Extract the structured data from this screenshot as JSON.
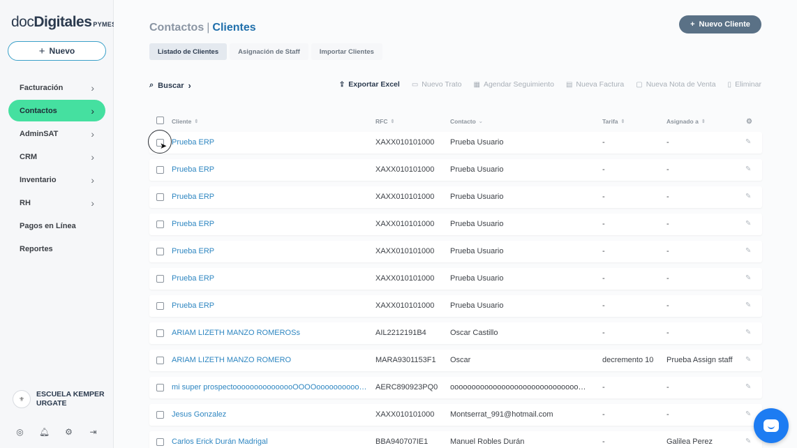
{
  "logo": {
    "doc": "doc",
    "digitales": "Digitales",
    "suffix": "PYMES"
  },
  "sidebar": {
    "new_button": "Nuevo",
    "items": [
      {
        "label": "Facturación",
        "chevron": true
      },
      {
        "label": "Contactos",
        "chevron": true
      },
      {
        "label": "AdminSAT",
        "chevron": true
      },
      {
        "label": "CRM",
        "chevron": true
      },
      {
        "label": "Inventario",
        "chevron": true
      },
      {
        "label": "RH",
        "chevron": true
      },
      {
        "label": "Pagos en Línea",
        "chevron": false
      },
      {
        "label": "Reportes",
        "chevron": false
      }
    ],
    "active_item": "Contactos",
    "org_name": "ESCUELA KEMPER URGATE",
    "footer_icons": [
      "user-icon",
      "bell-icon",
      "gear-icon",
      "logout-icon"
    ]
  },
  "header": {
    "section": "Contactos",
    "page": "Clientes",
    "new_client_button": "Nuevo Cliente"
  },
  "tabs": [
    "Listado de Clientes",
    "Asignación de Staff",
    "Importar Clientes"
  ],
  "active_tab": "Listado de Clientes",
  "toolbar": {
    "search_label": "Buscar",
    "actions": [
      {
        "label": "Exportar Excel",
        "icon": "upload-icon",
        "enabled": true
      },
      {
        "label": "Nuevo Trato",
        "icon": "briefcase-icon",
        "enabled": false
      },
      {
        "label": "Agendar Seguimiento",
        "icon": "calendar-icon",
        "enabled": false
      },
      {
        "label": "Nueva Factura",
        "icon": "invoice-icon",
        "enabled": false
      },
      {
        "label": "Nueva Nota de Venta",
        "icon": "note-icon",
        "enabled": false
      },
      {
        "label": "Eliminar",
        "icon": "trash-icon",
        "enabled": false
      }
    ]
  },
  "table": {
    "columns": [
      "Cliente",
      "RFC",
      "Contacto",
      "Tarifa",
      "Asignado a"
    ],
    "rows": [
      {
        "cliente": "Prueba ERP",
        "rfc": "XAXX010101000",
        "contacto": "Prueba Usuario",
        "tarifa": "-",
        "asignado": "-"
      },
      {
        "cliente": "Prueba ERP",
        "rfc": "XAXX010101000",
        "contacto": "Prueba Usuario",
        "tarifa": "-",
        "asignado": "-"
      },
      {
        "cliente": "Prueba ERP",
        "rfc": "XAXX010101000",
        "contacto": "Prueba Usuario",
        "tarifa": "-",
        "asignado": "-"
      },
      {
        "cliente": "Prueba ERP",
        "rfc": "XAXX010101000",
        "contacto": "Prueba Usuario",
        "tarifa": "-",
        "asignado": "-"
      },
      {
        "cliente": "Prueba ERP",
        "rfc": "XAXX010101000",
        "contacto": "Prueba Usuario",
        "tarifa": "-",
        "asignado": "-"
      },
      {
        "cliente": "Prueba ERP",
        "rfc": "XAXX010101000",
        "contacto": "Prueba Usuario",
        "tarifa": "-",
        "asignado": "-"
      },
      {
        "cliente": "Prueba ERP",
        "rfc": "XAXX010101000",
        "contacto": "Prueba Usuario",
        "tarifa": "-",
        "asignado": "-"
      },
      {
        "cliente": "ARIAM LIZETH MANZO ROMEROSs",
        "rfc": "AIL2212191B4",
        "contacto": "Oscar Castillo",
        "tarifa": "-",
        "asignado": "-"
      },
      {
        "cliente": "ARIAM LIZETH MANZO ROMERO",
        "rfc": "MARA9301153F1",
        "contacto": "Oscar",
        "tarifa": "decremento 10",
        "asignado": "Prueba Assign staff"
      },
      {
        "cliente": "mi super prospectooooooooooooooOOOOooooooooooooo...",
        "rfc": "AERC890923PQ0",
        "contacto": "oooooooooooooooooooooooooooooooo...",
        "tarifa": "-",
        "asignado": "-"
      },
      {
        "cliente": "Jesus Gonzalez",
        "rfc": "XAXX010101000",
        "contacto": "Montserrat_991@hotmail.com",
        "tarifa": "-",
        "asignado": "-"
      },
      {
        "cliente": "Carlos Erick Durán Madrigal",
        "rfc": "BBA940707IE1",
        "contacto": "Manuel Robles Durán",
        "tarifa": "-",
        "asignado": "Galilea Perez"
      }
    ]
  },
  "chat_widget": "chat-icon"
}
